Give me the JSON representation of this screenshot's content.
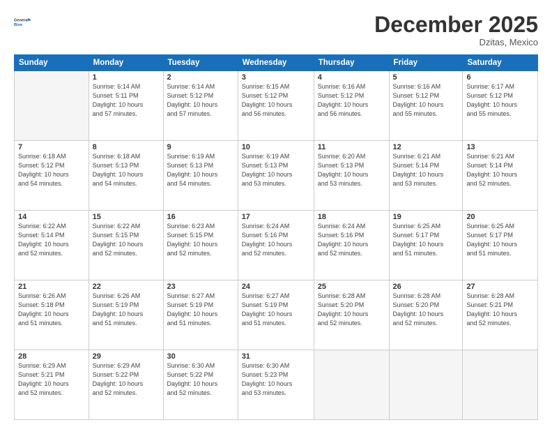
{
  "logo": {
    "line1": "General",
    "line2": "Blue"
  },
  "header": {
    "title": "December 2025",
    "location": "Dzitas, Mexico"
  },
  "weekdays": [
    "Sunday",
    "Monday",
    "Tuesday",
    "Wednesday",
    "Thursday",
    "Friday",
    "Saturday"
  ],
  "weeks": [
    [
      {
        "day": "",
        "info": ""
      },
      {
        "day": "1",
        "info": "Sunrise: 6:14 AM\nSunset: 5:11 PM\nDaylight: 10 hours\nand 57 minutes."
      },
      {
        "day": "2",
        "info": "Sunrise: 6:14 AM\nSunset: 5:12 PM\nDaylight: 10 hours\nand 57 minutes."
      },
      {
        "day": "3",
        "info": "Sunrise: 6:15 AM\nSunset: 5:12 PM\nDaylight: 10 hours\nand 56 minutes."
      },
      {
        "day": "4",
        "info": "Sunrise: 6:16 AM\nSunset: 5:12 PM\nDaylight: 10 hours\nand 56 minutes."
      },
      {
        "day": "5",
        "info": "Sunrise: 6:16 AM\nSunset: 5:12 PM\nDaylight: 10 hours\nand 55 minutes."
      },
      {
        "day": "6",
        "info": "Sunrise: 6:17 AM\nSunset: 5:12 PM\nDaylight: 10 hours\nand 55 minutes."
      }
    ],
    [
      {
        "day": "7",
        "info": "Sunrise: 6:18 AM\nSunset: 5:12 PM\nDaylight: 10 hours\nand 54 minutes."
      },
      {
        "day": "8",
        "info": "Sunrise: 6:18 AM\nSunset: 5:13 PM\nDaylight: 10 hours\nand 54 minutes."
      },
      {
        "day": "9",
        "info": "Sunrise: 6:19 AM\nSunset: 5:13 PM\nDaylight: 10 hours\nand 54 minutes."
      },
      {
        "day": "10",
        "info": "Sunrise: 6:19 AM\nSunset: 5:13 PM\nDaylight: 10 hours\nand 53 minutes."
      },
      {
        "day": "11",
        "info": "Sunrise: 6:20 AM\nSunset: 5:13 PM\nDaylight: 10 hours\nand 53 minutes."
      },
      {
        "day": "12",
        "info": "Sunrise: 6:21 AM\nSunset: 5:14 PM\nDaylight: 10 hours\nand 53 minutes."
      },
      {
        "day": "13",
        "info": "Sunrise: 6:21 AM\nSunset: 5:14 PM\nDaylight: 10 hours\nand 52 minutes."
      }
    ],
    [
      {
        "day": "14",
        "info": "Sunrise: 6:22 AM\nSunset: 5:14 PM\nDaylight: 10 hours\nand 52 minutes."
      },
      {
        "day": "15",
        "info": "Sunrise: 6:22 AM\nSunset: 5:15 PM\nDaylight: 10 hours\nand 52 minutes."
      },
      {
        "day": "16",
        "info": "Sunrise: 6:23 AM\nSunset: 5:15 PM\nDaylight: 10 hours\nand 52 minutes."
      },
      {
        "day": "17",
        "info": "Sunrise: 6:24 AM\nSunset: 5:16 PM\nDaylight: 10 hours\nand 52 minutes."
      },
      {
        "day": "18",
        "info": "Sunrise: 6:24 AM\nSunset: 5:16 PM\nDaylight: 10 hours\nand 52 minutes."
      },
      {
        "day": "19",
        "info": "Sunrise: 6:25 AM\nSunset: 5:17 PM\nDaylight: 10 hours\nand 51 minutes."
      },
      {
        "day": "20",
        "info": "Sunrise: 6:25 AM\nSunset: 5:17 PM\nDaylight: 10 hours\nand 51 minutes."
      }
    ],
    [
      {
        "day": "21",
        "info": "Sunrise: 6:26 AM\nSunset: 5:18 PM\nDaylight: 10 hours\nand 51 minutes."
      },
      {
        "day": "22",
        "info": "Sunrise: 6:26 AM\nSunset: 5:19 PM\nDaylight: 10 hours\nand 51 minutes."
      },
      {
        "day": "23",
        "info": "Sunrise: 6:27 AM\nSunset: 5:19 PM\nDaylight: 10 hours\nand 51 minutes."
      },
      {
        "day": "24",
        "info": "Sunrise: 6:27 AM\nSunset: 5:19 PM\nDaylight: 10 hours\nand 51 minutes."
      },
      {
        "day": "25",
        "info": "Sunrise: 6:28 AM\nSunset: 5:20 PM\nDaylight: 10 hours\nand 52 minutes."
      },
      {
        "day": "26",
        "info": "Sunrise: 6:28 AM\nSunset: 5:20 PM\nDaylight: 10 hours\nand 52 minutes."
      },
      {
        "day": "27",
        "info": "Sunrise: 6:28 AM\nSunset: 5:21 PM\nDaylight: 10 hours\nand 52 minutes."
      }
    ],
    [
      {
        "day": "28",
        "info": "Sunrise: 6:29 AM\nSunset: 5:21 PM\nDaylight: 10 hours\nand 52 minutes."
      },
      {
        "day": "29",
        "info": "Sunrise: 6:29 AM\nSunset: 5:22 PM\nDaylight: 10 hours\nand 52 minutes."
      },
      {
        "day": "30",
        "info": "Sunrise: 6:30 AM\nSunset: 5:22 PM\nDaylight: 10 hours\nand 52 minutes."
      },
      {
        "day": "31",
        "info": "Sunrise: 6:30 AM\nSunset: 5:23 PM\nDaylight: 10 hours\nand 53 minutes."
      },
      {
        "day": "",
        "info": ""
      },
      {
        "day": "",
        "info": ""
      },
      {
        "day": "",
        "info": ""
      }
    ]
  ]
}
